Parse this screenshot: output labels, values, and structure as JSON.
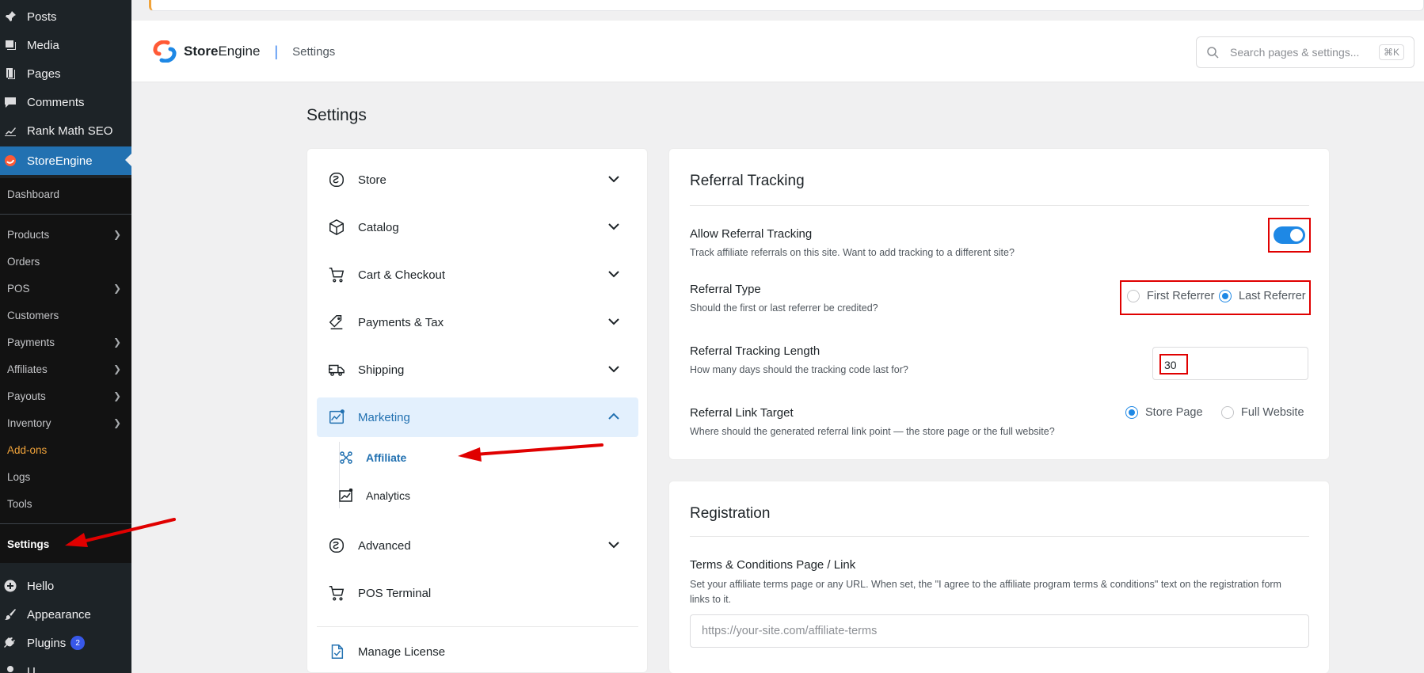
{
  "wp_sidebar": {
    "top_items": [
      {
        "label": "Posts",
        "icon": "pushpin-icon"
      },
      {
        "label": "Media",
        "icon": "media-icon"
      },
      {
        "label": "Pages",
        "icon": "pages-icon"
      },
      {
        "label": "Comments",
        "icon": "comments-icon"
      },
      {
        "label": "Rank Math SEO",
        "icon": "rankmath-icon"
      },
      {
        "label": "StoreEngine",
        "icon": "storeengine-icon"
      }
    ],
    "submenu": {
      "dashboard": "Dashboard",
      "products": "Products",
      "orders": "Orders",
      "pos": "POS",
      "customers": "Customers",
      "payments": "Payments",
      "affiliates": "Affiliates",
      "payouts": "Payouts",
      "inventory": "Inventory",
      "addons": "Add-ons",
      "logs": "Logs",
      "tools": "Tools",
      "settings": "Settings"
    },
    "bottom_items": {
      "hello": "Hello",
      "appearance": "Appearance",
      "plugins": "Plugins",
      "plugins_badge": "2",
      "users": "U"
    }
  },
  "header": {
    "brand_bold": "Store",
    "brand_rest": "Engine",
    "separator": "|",
    "breadcrumb": "Settings",
    "search_placeholder": "Search pages & settings...",
    "search_shortcut": "⌘K"
  },
  "page_title": "Settings",
  "settings_menu": {
    "store": "Store",
    "catalog": "Catalog",
    "cart_checkout": "Cart & Checkout",
    "payments_tax": "Payments & Tax",
    "shipping": "Shipping",
    "marketing": "Marketing",
    "affiliate": "Affiliate",
    "analytics": "Analytics",
    "advanced": "Advanced",
    "pos_terminal": "POS Terminal",
    "manage_license": "Manage License"
  },
  "referral_tracking": {
    "title": "Referral Tracking",
    "allow": {
      "label": "Allow Referral Tracking",
      "desc": "Track affiliate referrals on this site. Want to add tracking to a different site?",
      "enabled": true
    },
    "type": {
      "label": "Referral Type",
      "desc": "Should the first or last referrer be credited?",
      "option_first": "First Referrer",
      "option_last": "Last Referrer",
      "selected": "Last Referrer"
    },
    "length": {
      "label": "Referral Tracking Length",
      "desc": "How many days should the tracking code last for?",
      "value": "30"
    },
    "link_target": {
      "label": "Referral Link Target",
      "desc": "Where should the generated referral link point — the store page or the full website?",
      "option_store": "Store Page",
      "option_full": "Full Website",
      "selected": "Store Page"
    }
  },
  "registration": {
    "title": "Registration",
    "terms_label": "Terms & Conditions Page / Link",
    "terms_desc_1": "Set your affiliate terms page or any URL. When set, the \"I agree to the affiliate program terms & conditions\" text on the registration form",
    "terms_desc_2": "links to it.",
    "terms_placeholder": "https://your-site.com/affiliate-terms"
  },
  "colors": {
    "accent": "#2271b1",
    "toggle_on": "#1e88e5",
    "annotation": "#e00000",
    "wp_sidebar_bg": "#1d2327"
  }
}
